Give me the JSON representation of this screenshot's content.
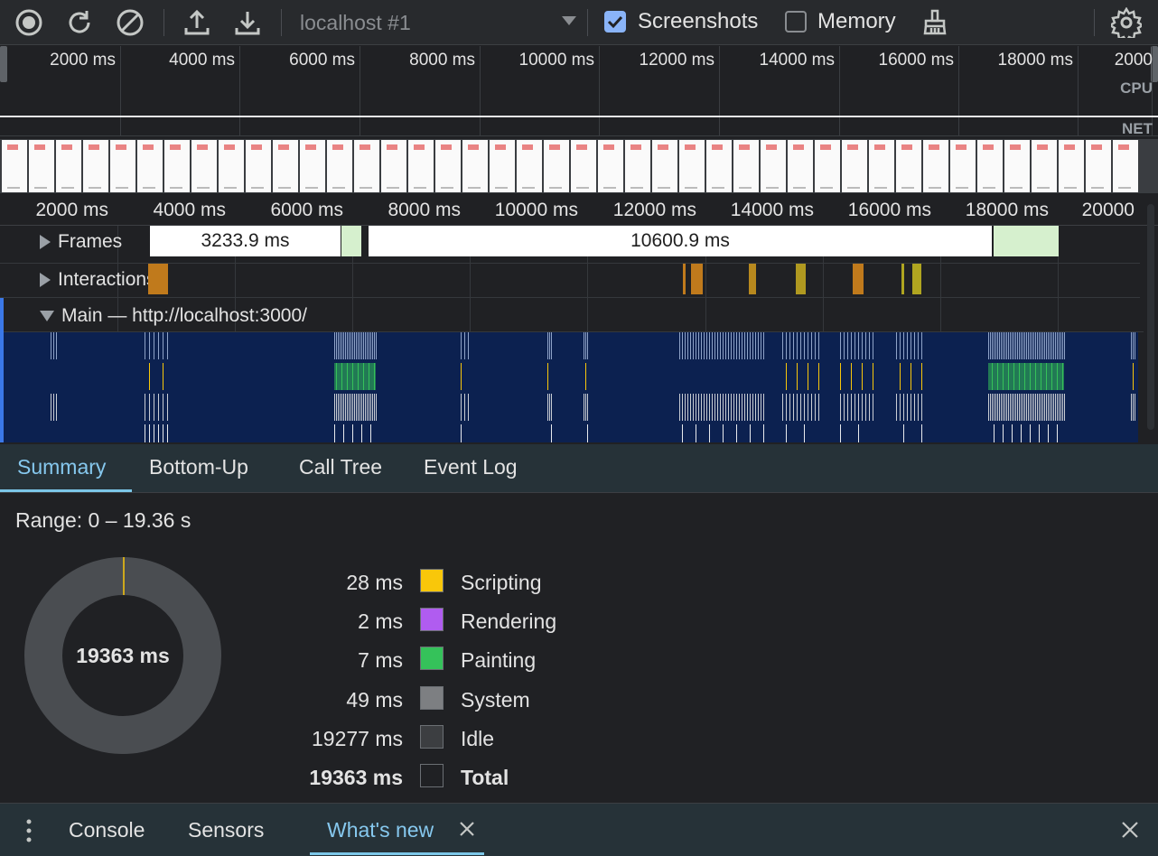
{
  "toolbar": {
    "profile_select": "localhost #1",
    "screenshots_label": "Screenshots",
    "memory_label": "Memory"
  },
  "overview": {
    "ticks": [
      "2000 ms",
      "4000 ms",
      "6000 ms",
      "8000 ms",
      "10000 ms",
      "12000 ms",
      "14000 ms",
      "16000 ms",
      "18000 ms",
      "2000"
    ],
    "cpu_label": "CPU",
    "net_label": "NET"
  },
  "timeline": {
    "ticks": [
      "2000 ms",
      "4000 ms",
      "6000 ms",
      "8000 ms",
      "10000 ms",
      "12000 ms",
      "14000 ms",
      "16000 ms",
      "18000 ms",
      "20000"
    ],
    "frames_label": "Frames",
    "frame_1": "3233.9 ms",
    "frame_2": "10600.9 ms",
    "interactions_label": "Interactions",
    "main_label": "Main — http://localhost:3000/"
  },
  "details_tabs": [
    "Summary",
    "Bottom-Up",
    "Call Tree",
    "Event Log"
  ],
  "summary": {
    "range": "Range: 0 – 19.36 s",
    "total_center": "19363 ms",
    "rows": [
      {
        "value": "28 ms",
        "name": "Scripting",
        "color": "#f9c70a"
      },
      {
        "value": "2 ms",
        "name": "Rendering",
        "color": "#b05cf0"
      },
      {
        "value": "7 ms",
        "name": "Painting",
        "color": "#35c25a"
      },
      {
        "value": "49 ms",
        "name": "System",
        "color": "#7d7f82"
      },
      {
        "value": "19277 ms",
        "name": "Idle",
        "color": "#3c3e41"
      },
      {
        "value": "19363 ms",
        "name": "Total",
        "color": "#202124"
      }
    ]
  },
  "drawer": {
    "tabs": [
      "Console",
      "Sensors",
      "What's new"
    ]
  }
}
